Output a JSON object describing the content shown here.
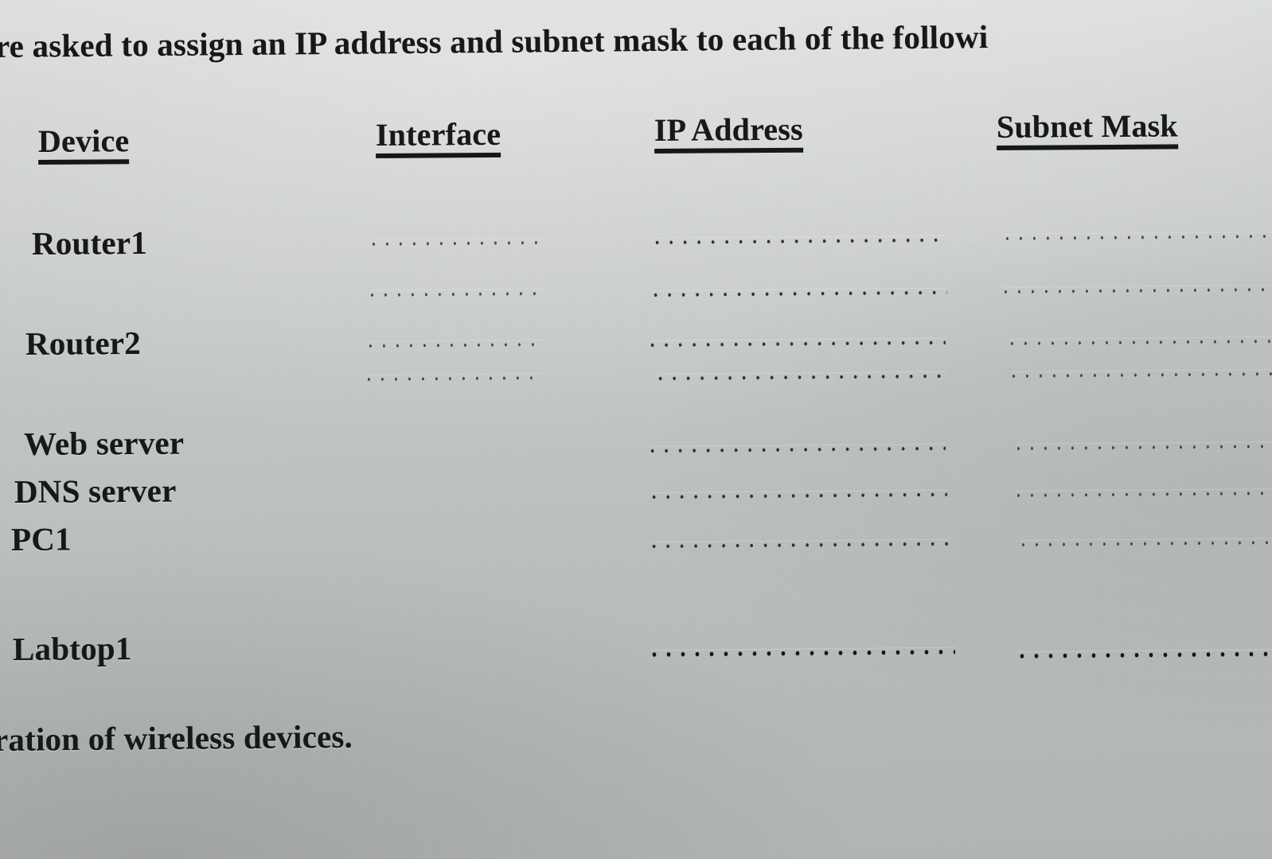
{
  "document": {
    "kind": "scanned-worksheet-photo",
    "background_color": "#c2c6c4",
    "ink_color": "#16181a"
  },
  "prompt_line": "re asked to assign an IP address and subnet mask to each of the followi",
  "footer_line": "ration of wireless devices.",
  "table": {
    "headers": [
      {
        "label": "Device"
      },
      {
        "label": "Interface"
      },
      {
        "label": "IP Address"
      },
      {
        "label": "Subnet Mask"
      }
    ],
    "rows": [
      {
        "device": "Router1",
        "interface_blanks": 2,
        "ip_blanks": 2,
        "mask_blanks": 2
      },
      {
        "device": "Router2",
        "interface_blanks": 2,
        "ip_blanks": 2,
        "mask_blanks": 2
      },
      {
        "device": "Web server",
        "interface_blanks": 0,
        "ip_blanks": 1,
        "mask_blanks": 1
      },
      {
        "device": "DNS server",
        "interface_blanks": 0,
        "ip_blanks": 1,
        "mask_blanks": 1
      },
      {
        "device": "PC1",
        "interface_blanks": 0,
        "ip_blanks": 1,
        "mask_blanks": 1
      },
      {
        "device": "Labtop1",
        "interface_blanks": 0,
        "ip_blanks": 1,
        "mask_blanks": 1
      }
    ]
  }
}
